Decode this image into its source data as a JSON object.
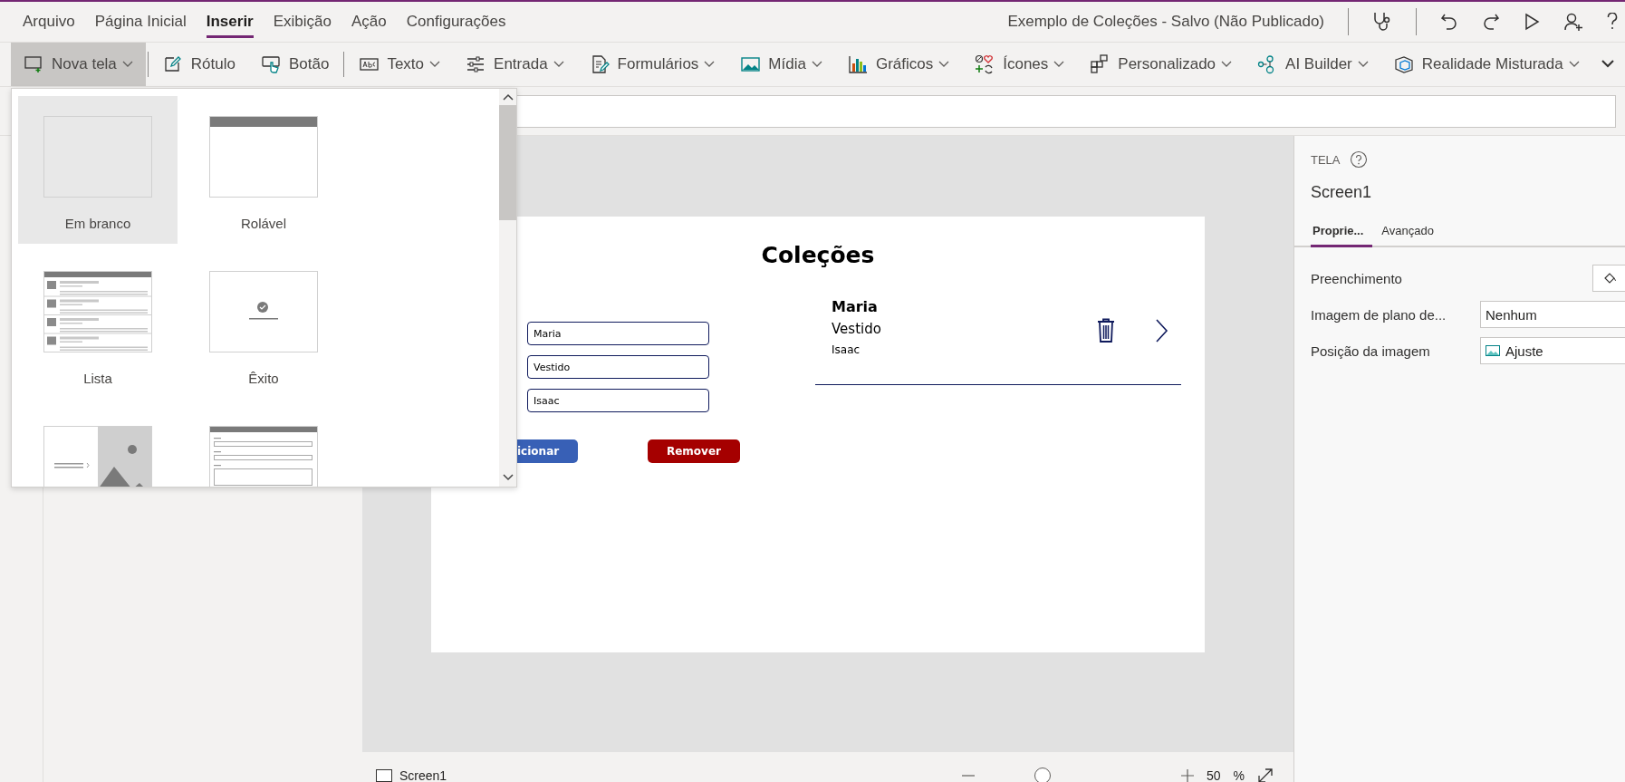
{
  "menu": [
    {
      "label": "Arquivo",
      "selected": false
    },
    {
      "label": "Página Inicial",
      "selected": false
    },
    {
      "label": "Inserir",
      "selected": true
    },
    {
      "label": "Exibição",
      "selected": false
    },
    {
      "label": "Ação",
      "selected": false
    },
    {
      "label": "Configurações",
      "selected": false
    }
  ],
  "document_title": "Exemplo de Coleções - Salvo (Não Publicado)",
  "ribbon": [
    {
      "kind": "screen",
      "label": "Nova tela",
      "caret": true,
      "selected": true
    },
    {
      "kind": "label",
      "label": "Rótulo",
      "caret": false,
      "selected": false
    },
    {
      "kind": "button",
      "label": "Botão",
      "caret": false,
      "selected": false
    },
    {
      "kind": "text",
      "label": "Texto",
      "caret": true,
      "selected": false
    },
    {
      "kind": "input",
      "label": "Entrada",
      "caret": true,
      "selected": false
    },
    {
      "kind": "forms",
      "label": "Formulários",
      "caret": true,
      "selected": false
    },
    {
      "kind": "media",
      "label": "Mídia",
      "caret": true,
      "selected": false
    },
    {
      "kind": "charts",
      "label": "Gráficos",
      "caret": true,
      "selected": false
    },
    {
      "kind": "icons",
      "label": "Ícones",
      "caret": true,
      "selected": false
    },
    {
      "kind": "custom",
      "label": "Personalizado",
      "caret": true,
      "selected": false
    },
    {
      "kind": "ai",
      "label": "AI Builder",
      "caret": true,
      "selected": false
    },
    {
      "kind": "mixed",
      "label": "Realidade Misturada",
      "caret": true,
      "selected": false
    }
  ],
  "new_screen_gallery": {
    "tiles": [
      {
        "kind": "blank",
        "label": "Em branco",
        "selected": true
      },
      {
        "kind": "scrollable",
        "label": "Rolável",
        "selected": false
      },
      {
        "kind": "list",
        "label": "Lista",
        "selected": false
      },
      {
        "kind": "success",
        "label": "Êxito",
        "selected": false
      },
      {
        "kind": "split",
        "selected": false
      },
      {
        "kind": "form",
        "selected": false
      }
    ]
  },
  "app_screen": {
    "title": "Coleções",
    "inputs": [
      {
        "value": "Maria"
      },
      {
        "value": "Vestido"
      },
      {
        "value": "Isaac"
      }
    ],
    "buttons": [
      {
        "kind": "primary",
        "label": "icionar"
      },
      {
        "kind": "danger",
        "label": "Remover"
      }
    ],
    "gallery_item": {
      "title": "Maria",
      "subtitle": "Vestido",
      "body": "Isaac"
    }
  },
  "properties": {
    "heading": "TELA",
    "name": "Screen1",
    "tabs": [
      {
        "label": "Proprie...",
        "selected": true
      },
      {
        "label": "Avançado",
        "selected": false
      }
    ],
    "rows": [
      {
        "kind": "color",
        "label": "Preenchimento"
      },
      {
        "kind": "dropdown",
        "label": "Imagem de plano de...",
        "value": "Nenhum"
      },
      {
        "kind": "image-dropdown",
        "label": "Posição da imagem",
        "value": "Ajuste"
      }
    ]
  },
  "status_bar": {
    "screen": "Screen1",
    "zoom": {
      "level": 0.3
    },
    "zoom_value": "50",
    "zoom_unit": "%"
  }
}
